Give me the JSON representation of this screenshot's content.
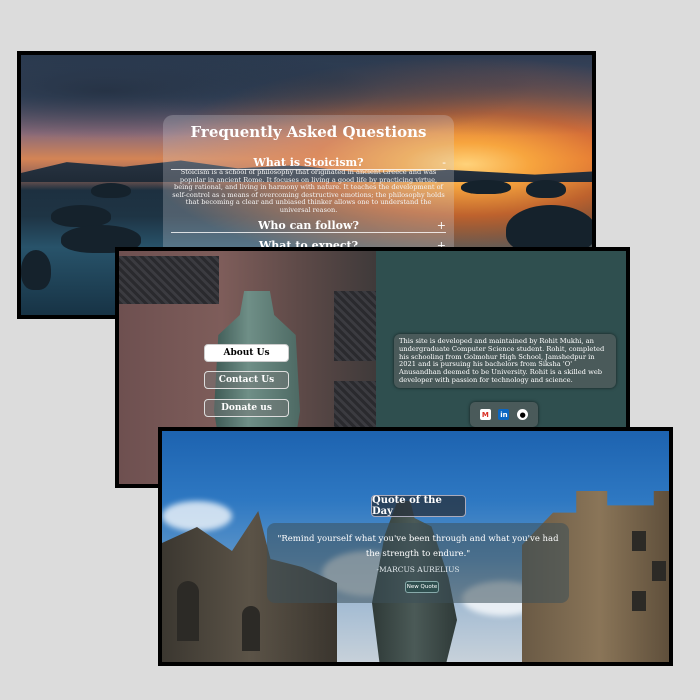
{
  "faq": {
    "title": "Frequently Asked Questions",
    "items": [
      {
        "question": "What is Stoicism?",
        "toggle": "-",
        "answer": "Stoicism is a school of philosophy that originated in ancient Greece and was popular in ancient Rome. It focuses on living a good life by practicing virtue, being rational, and living in harmony with nature. It teaches the development of self-control as a means of overcoming destructive emotions; the philosophy holds that becoming a clear and unbiased thinker allows one to understand the universal reason."
      },
      {
        "question": "Who can follow?",
        "toggle": "+"
      },
      {
        "question": "What to expect?",
        "toggle": "+"
      }
    ]
  },
  "about": {
    "nav": {
      "about_label": "About Us",
      "contact_label": "Contact Us",
      "donate_label": "Donate us"
    },
    "bio": "This site is developed and maintained by Rohit Mukhi, an undergraduate Computer Science student. Rohit, completed his schooling from Golmohur High School, Jamshedpur in 2021 and is pursuing his bachelors from Siksha 'O' Anusandhan deemed to be University. Rohit is a skilled web developer with passion for technology and science.",
    "social": {
      "icons": [
        "gmail-icon",
        "linkedin-icon",
        "github-icon"
      ],
      "gmail_glyph": "M",
      "linkedin_glyph": "in",
      "github_glyph": "●"
    }
  },
  "quote": {
    "heading": "Quote of the Day",
    "text": "\"Remind yourself what you've been through and what you've had the strength to endure.\"",
    "author": "-MARCUS AURELIUS",
    "button_label": "New Quote"
  },
  "colors": {
    "teal": "#2f4f4f",
    "card": "#4a5a5a",
    "gmail_red": "#d93025",
    "linkedin_blue": "#0a66c2"
  }
}
